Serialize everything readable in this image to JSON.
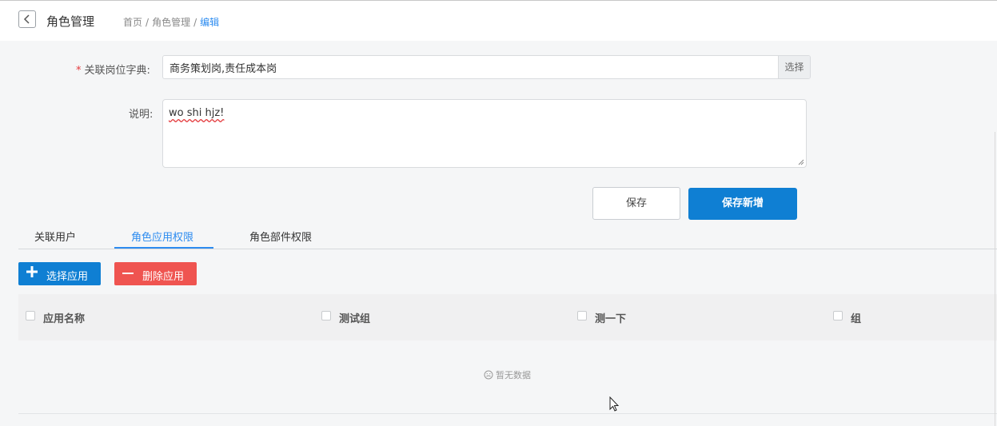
{
  "header": {
    "title": "角色管理",
    "breadcrumb": [
      "首页",
      "角色管理",
      "编辑"
    ],
    "separator": "/"
  },
  "form": {
    "position_dict": {
      "required_mark": "*",
      "label": "关联岗位字典:",
      "value": "商务策划岗,责任成本岗",
      "addon_label": "选择"
    },
    "description": {
      "label": "说明:",
      "value": "wo shi hjz!"
    },
    "save_label": "保存",
    "save_new_label": "保存新增"
  },
  "tabs": [
    {
      "label": "关联用户"
    },
    {
      "label": "角色应用权限",
      "active": true
    },
    {
      "label": "角色部件权限"
    }
  ],
  "actions": {
    "select_app_label": "选择应用",
    "delete_app_label": "删除应用"
  },
  "table": {
    "columns": [
      "应用名称",
      "测试组",
      "测一下",
      "组"
    ],
    "empty_text": "暂无数据"
  },
  "colors": {
    "primary": "#0f7fd3",
    "danger": "#ef5450",
    "link": "#2d8cf0",
    "required": "#e4393c"
  }
}
